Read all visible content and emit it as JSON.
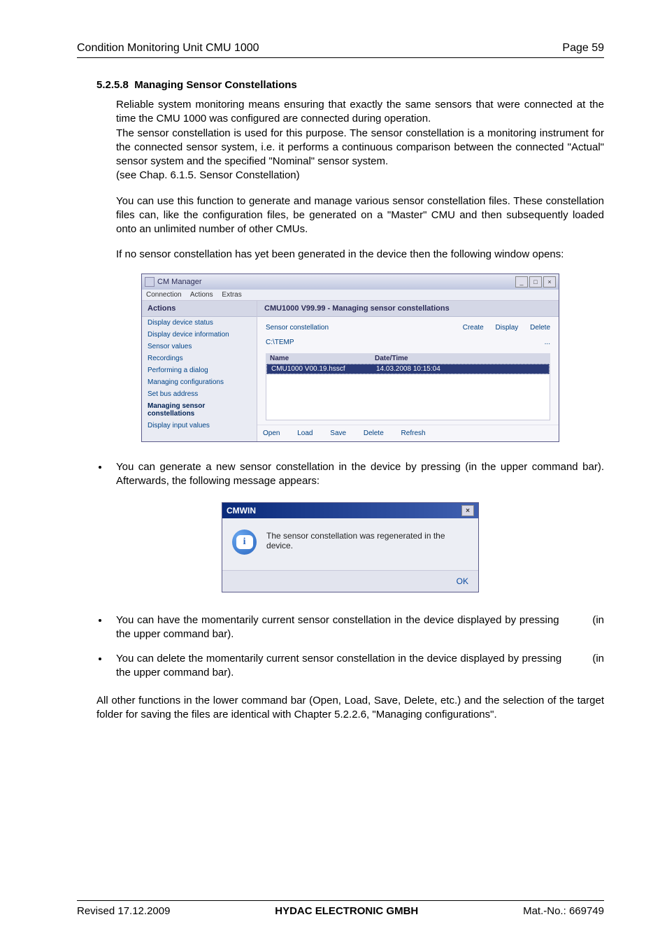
{
  "header": {
    "left": "Condition Monitoring Unit CMU 1000",
    "right": "Page 59"
  },
  "section": {
    "number": "5.2.5.8",
    "title": "Managing Sensor Constellations"
  },
  "paragraphs": {
    "p1": "Reliable system monitoring means ensuring that exactly the same sensors that were connected at the time the CMU 1000 was configured are connected during operation.",
    "p2": "The sensor constellation is used for this purpose. The sensor constellation is a monitoring instrument for the connected sensor system, i.e. it performs a continuous comparison between the connected \"Actual\" sensor system and the specified \"Nominal\" sensor system.",
    "p3": "(see Chap. 6.1.5. Sensor Constellation)",
    "p4": "You can use this function to generate and manage various sensor constellation files. These constellation files can, like the configuration files, be generated on a \"Master\" CMU and then subsequently loaded onto an unlimited number of other CMUs.",
    "p5": "If no sensor constellation has yet been generated in the device then the following window opens:",
    "p6": "All other functions in the lower command bar (Open, Load, Save, Delete, etc.) and the selection of the target folder for saving the files are identical with Chapter 5.2.2.6, \"Managing configurations\"."
  },
  "bullets": {
    "b1a": "You can generate a new sensor constellation in the device by pressing",
    "b1b": "(in the upper command bar). Afterwards, the following message appears:",
    "b2a": "You can have the momentarily current sensor constellation in the device displayed by pressing",
    "b2b": "(in the upper command bar).",
    "b3a": "You can delete the momentarily current sensor constellation in the device displayed by pressing",
    "b3b": "(in the upper command bar)."
  },
  "app": {
    "title": "CM Manager",
    "menus": {
      "m1": "Connection",
      "m2": "Actions",
      "m3": "Extras"
    },
    "sidebar_header": "Actions",
    "sidebar": [
      "Display device status",
      "Display device information",
      "Sensor values",
      "Recordings",
      "Performing a dialog",
      "Managing configurations",
      "Set bus address",
      "Managing sensor constellations",
      "Display input values"
    ],
    "content_title": "CMU1000 V99.99 - Managing sensor constellations",
    "row1_label": "Sensor constellation",
    "row1_actions": {
      "create": "Create",
      "display": "Display",
      "delete": "Delete"
    },
    "row2_path": "C:\\TEMP",
    "row2_more": "...",
    "cols": {
      "name": "Name",
      "date": "Date/Time"
    },
    "file": {
      "name": "CMU1000 V00.19.hsscf",
      "date": "14.03.2008  10:15:04"
    },
    "bottom": {
      "open": "Open",
      "load": "Load",
      "save": "Save",
      "delete": "Delete",
      "refresh": "Refresh"
    }
  },
  "dialog": {
    "title": "CMWIN",
    "message": "The sensor constellation was regenerated in the device.",
    "ok": "OK",
    "info_glyph": "i"
  },
  "footer": {
    "left": "Revised 17.12.2009",
    "center": "HYDAC ELECTRONIC GMBH",
    "right": "Mat.-No.: 669749"
  }
}
